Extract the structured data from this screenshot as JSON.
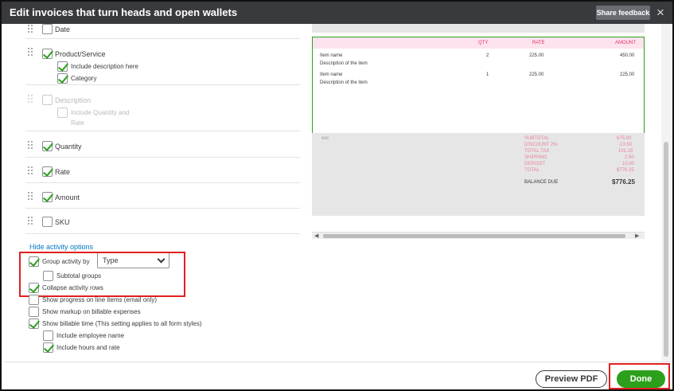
{
  "header": {
    "title": "Edit invoices that turn heads and open wallets",
    "share_feedback": "Share feedback",
    "close_glyph": "×"
  },
  "fields": [
    {
      "label": "Date",
      "checked": false
    },
    {
      "label": "Product/Service",
      "checked": true,
      "sub": [
        {
          "label": "Include description here",
          "checked": true
        },
        {
          "label": "Category",
          "checked": true
        }
      ]
    },
    {
      "label": "Description",
      "checked": false,
      "disabled": true,
      "sub": [
        {
          "label": "Include Quantity and",
          "label2": "Rate",
          "checked": false
        }
      ]
    },
    {
      "label": "Quantity",
      "checked": true
    },
    {
      "label": "Rate",
      "checked": true
    },
    {
      "label": "Amount",
      "checked": true
    },
    {
      "label": "SKU",
      "checked": false
    }
  ],
  "activity": {
    "link": "Hide activity options",
    "group_by_label": "Group activity by",
    "group_by_value": "Type",
    "subtotal_groups": "Subtotal groups",
    "collapse_rows": "Collapse activity rows",
    "show_progress": "Show progress on line items (email only)",
    "show_markup": "Show markup on billable expenses",
    "show_billable_time": "Show billable time (This setting applies to all form styles)",
    "include_employee": "Include employee name",
    "include_hours": "Include hours and rate"
  },
  "preview": {
    "columns": [
      "QTY",
      "RATE",
      "AMOUNT"
    ],
    "rows": [
      {
        "name": "Item name",
        "desc": "Description of the item",
        "qty": "2",
        "rate": "225.00",
        "amount": "450.00"
      },
      {
        "name": "Item name",
        "desc": "Description of the item",
        "qty": "1",
        "rate": "225.00",
        "amount": "225.00"
      }
    ],
    "tax_flag": "exc",
    "totals": [
      {
        "label": "SUBTOTAL",
        "value": "675.00"
      },
      {
        "label": "DISCOUNT 2%",
        "value": "-13.50"
      },
      {
        "label": "TOTAL TAX",
        "value": "101.25"
      },
      {
        "label": "SHIPPING",
        "value": "2.50"
      },
      {
        "label": "DEPOSIT",
        "value": "10.00"
      },
      {
        "label": "TOTAL",
        "value": "$776.25"
      }
    ],
    "balance_label": "BALANCE DUE",
    "balance_value": "$776.25"
  },
  "footer": {
    "preview_pdf": "Preview PDF",
    "done": "Done"
  },
  "colors": {
    "accent": "#2ca01c",
    "title_bar": "#393a3d",
    "highlight": "#e02020",
    "link": "#0077c5"
  }
}
